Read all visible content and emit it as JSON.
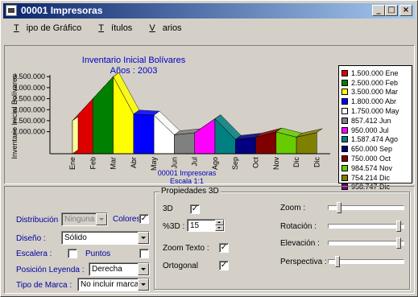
{
  "window": {
    "title": "00001 Impresoras",
    "buttons": {
      "minimize": "_",
      "maximize": "□",
      "close": "×"
    }
  },
  "menu": {
    "items": [
      {
        "first": "T",
        "rest": "ipo de Gráfico"
      },
      {
        "first": "T",
        "rest": "ítulos"
      },
      {
        "first": "V",
        "rest": "arios"
      }
    ]
  },
  "chart_data": {
    "type": "area",
    "title": "Inventario Inicial  Bolívares",
    "subtitle": "Años : 2003",
    "ylabel": "Inventario Inicial  Bolívares",
    "xlabel": "00001 Impresoras",
    "xlabel2": "Escala 1:1",
    "ylim": [
      0,
      3800000
    ],
    "yticks": [
      "3.500.000",
      "3.000.000",
      "2.500.000",
      "2.000.000",
      "1.500.000",
      "1.000.000"
    ],
    "ytick_values": [
      3500000,
      3000000,
      2500000,
      2000000,
      1500000,
      1000000
    ],
    "categories": [
      "Ene",
      "Feb",
      "Mar",
      "Abr",
      "May",
      "Jun",
      "Jul",
      "Ago",
      "Sep",
      "Oct",
      "Nov",
      "Dic",
      "Dic"
    ],
    "values": [
      1500000,
      2500000,
      3500000,
      1800000,
      1750000,
      857412,
      950000,
      1587474,
      650000,
      750000,
      984574,
      754214,
      958747
    ],
    "legend": [
      {
        "label": "1.500.000 Ene",
        "color": "#dd0000"
      },
      {
        "label": "2.500.000 Feb",
        "color": "#008000"
      },
      {
        "label": "3.500.000 Mar",
        "color": "#ffff00"
      },
      {
        "label": "1.800.000 Abr",
        "color": "#0000ff"
      },
      {
        "label": "1.750.000 May",
        "color": "#ffffff"
      },
      {
        "label": "857.412 Jun",
        "color": "#808080"
      },
      {
        "label": "950.000 Jul",
        "color": "#ff00ff"
      },
      {
        "label": "1.587.474 Ago",
        "color": "#008080"
      },
      {
        "label": "650.000 Sep",
        "color": "#000080"
      },
      {
        "label": "750.000 Oct",
        "color": "#800000"
      },
      {
        "label": "984.574 Nov",
        "color": "#66cc00"
      },
      {
        "label": "754.214 Dic",
        "color": "#808000"
      },
      {
        "label": "958.747 Dic",
        "color": "#800080"
      }
    ],
    "legend_placement": "right",
    "grid": false
  },
  "controls": {
    "distribucion": {
      "label": "Distribución",
      "value": "Ninguna"
    },
    "colores": {
      "label": "Colores",
      "checked": "✓"
    },
    "diseno": {
      "label": "Diseño :",
      "value": "Sólido"
    },
    "escalera": {
      "label": "Escalera :"
    },
    "puntos": {
      "label": "Puntos"
    },
    "posicion_leyenda": {
      "label": "Posición Leyenda :",
      "value": "Derecha"
    },
    "tipo_marca": {
      "label": "Tipo de Marca :",
      "value": "No incluir marcas"
    }
  },
  "propiedades3d": {
    "title": "Propiedades 3D",
    "d3": {
      "label": "3D",
      "checked": "✓"
    },
    "pct3d": {
      "label": "%3D :",
      "value": "15"
    },
    "zoom_texto": {
      "label": "Zoom Texto :",
      "checked": "✓"
    },
    "ortogonal": {
      "label": "Ortogonal",
      "checked": "✓"
    },
    "zoom": {
      "label": "Zoom :",
      "level": 0.12
    },
    "rotacion": {
      "label": "Rotación :",
      "level": 0.95
    },
    "elevacion": {
      "label": "Elevación :",
      "level": 0.95
    },
    "perspectiva": {
      "label": "Perspectiva :",
      "level": 0.1
    }
  }
}
